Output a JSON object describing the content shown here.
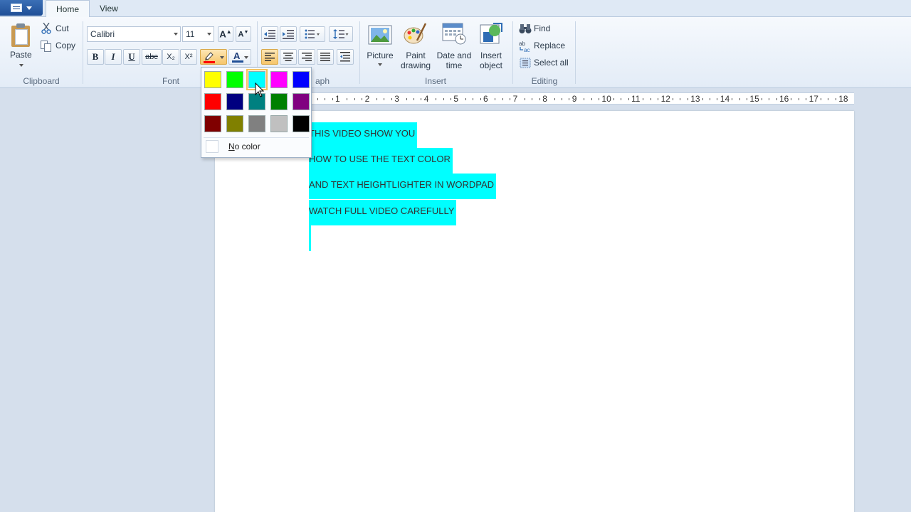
{
  "tabs": [
    {
      "label": "Home"
    },
    {
      "label": "View"
    }
  ],
  "clipboard": {
    "paste_label": "Paste",
    "cut_label": "Cut",
    "copy_label": "Copy",
    "group_label": "Clipboard"
  },
  "font": {
    "family": "Calibri",
    "size": "11",
    "bold": "B",
    "italic": "I",
    "underline": "U",
    "strikethrough": "abc",
    "subscript": "X₂",
    "superscript": "X²",
    "group_label": "Font"
  },
  "paragraph": {
    "group_label_visible": "aph"
  },
  "insert": {
    "picture_label": "Picture",
    "paint_label_1": "Paint",
    "paint_label_2": "drawing",
    "datetime_label_1": "Date and",
    "datetime_label_2": "time",
    "object_label_1": "Insert",
    "object_label_2": "object",
    "group_label": "Insert"
  },
  "editing": {
    "find_label": "Find",
    "replace_label": "Replace",
    "select_all_label": "Select all",
    "group_label": "Editing"
  },
  "ruler": {
    "labels": [
      "1",
      "2",
      "3",
      "4",
      "5",
      "6",
      "7",
      "8",
      "9",
      "10",
      "11",
      "12",
      "13",
      "14",
      "15",
      "16",
      "17",
      "18"
    ]
  },
  "document": {
    "lines": [
      "THIS VIDEO SHOW YOU",
      "HOW TO USE THE TEXT COLOR",
      "AND TEXT HEIGHTLIGHTER IN WORDPAD",
      "WATCH FULL VIDEO CAREFULLY"
    ],
    "highlight_color": "#00ffff"
  },
  "highlight_popup": {
    "colors": [
      [
        "#ffff00",
        "#00ff00",
        "#00ffff",
        "#ff00ff",
        "#0000ff"
      ],
      [
        "#ff0000",
        "#000080",
        "#008080",
        "#008000",
        "#800080"
      ],
      [
        "#800000",
        "#808000",
        "#808080",
        "#c0c0c0",
        "#000000"
      ]
    ],
    "selected": "#00ffff",
    "no_color_label": "No color"
  }
}
